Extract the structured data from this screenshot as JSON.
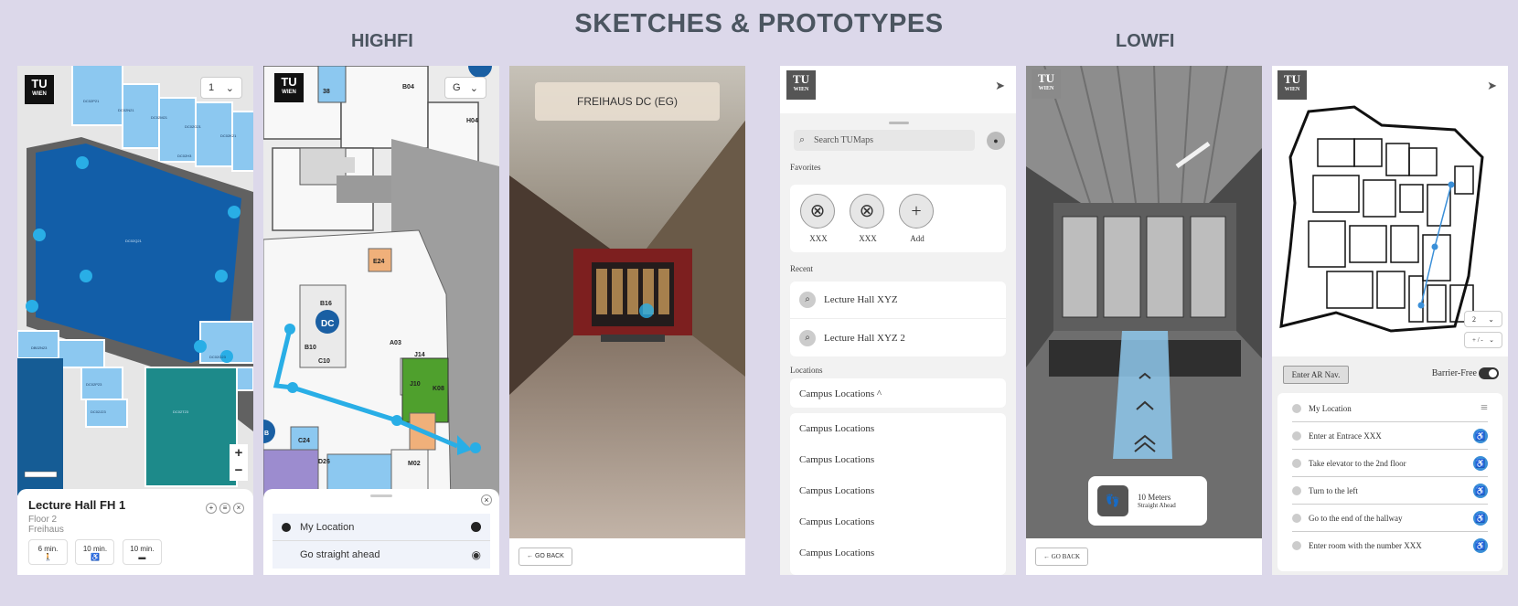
{
  "titles": {
    "main": "SKETCHES & PROTOTYPES",
    "highfi": "HIGHFI",
    "lowfi": "LOWFI"
  },
  "logo": {
    "line1": "TU",
    "line2": "WIEN"
  },
  "panel1": {
    "floor_select": "1",
    "zoom_in": "+",
    "zoom_out": "−",
    "rooms": [
      "DC02P21",
      "DC02N21",
      "DC02M21",
      "DC02G21",
      "DC02K21",
      "DC02H3",
      "DC02N23",
      "DC02P23",
      "DC02J23",
      "DC02G23",
      "DC02Q21",
      "DC02T23"
    ],
    "card": {
      "title": "Lecture Hall FH 1",
      "floor": "Floor 2",
      "building": "Freihaus",
      "chips": [
        {
          "time": "6 min.",
          "icon": "walk-icon"
        },
        {
          "time": "10 min.",
          "icon": "wheelchair-icon"
        },
        {
          "time": "10 min.",
          "icon": "bus-icon"
        }
      ]
    }
  },
  "panel2": {
    "floor_select": "G",
    "room_labels": [
      "38",
      "B04",
      "H04",
      "E24",
      "B16",
      "DC",
      "B10",
      "A03",
      "J14",
      "C10",
      "J10",
      "K08",
      "C24",
      "D26",
      "M02",
      "B"
    ],
    "steps": [
      {
        "label": "My Location",
        "icon": "edit-icon"
      },
      {
        "label": "Go straight ahead",
        "icon": "eye-icon"
      }
    ]
  },
  "panel3": {
    "location_label": "FREIHAUS DC (EG)",
    "go_back": "← GO BACK"
  },
  "panel4": {
    "search_placeholder": "Search TUMaps",
    "favorites_title": "Favorites",
    "favorites": [
      {
        "label": "XXX",
        "icon": "x-circle-icon"
      },
      {
        "label": "XXX",
        "icon": "x-circle-icon"
      },
      {
        "label": "Add",
        "icon": "plus-icon"
      }
    ],
    "recent_title": "Recent",
    "recent": [
      "Lecture Hall XYZ",
      "Lecture Hall XYZ 2"
    ],
    "locations_title": "Locations",
    "locations_dropdown": "Campus Locations ^",
    "locations": [
      "Campus Locations",
      "Campus Locations",
      "Campus Locations",
      "Campus Locations",
      "Campus Locations"
    ]
  },
  "panel5": {
    "distance": "10 Meters",
    "direction": "Straight Ahead",
    "go_back": "← GO BACK"
  },
  "panel6": {
    "floor_select": "2",
    "floor_select2": "+ / -",
    "ar_button": "Enter AR Nav.",
    "barrier_free": "Barrier-Free",
    "steps": [
      "My Location",
      "Enter at Entrace XXX",
      "Take elevator to the 2nd floor",
      "Turn to the left",
      "Go to the end of the hallway",
      "Enter room with the number XXX"
    ]
  },
  "colors": {
    "accent": "#29aee6",
    "dark_blue": "#1a5fa3",
    "light_blue": "#8cc8f0",
    "teal": "#1d8a8a",
    "green": "#4fa02d",
    "orange": "#f0b07a",
    "purple": "#9c8ccf",
    "bg": "#dcd8ea"
  }
}
